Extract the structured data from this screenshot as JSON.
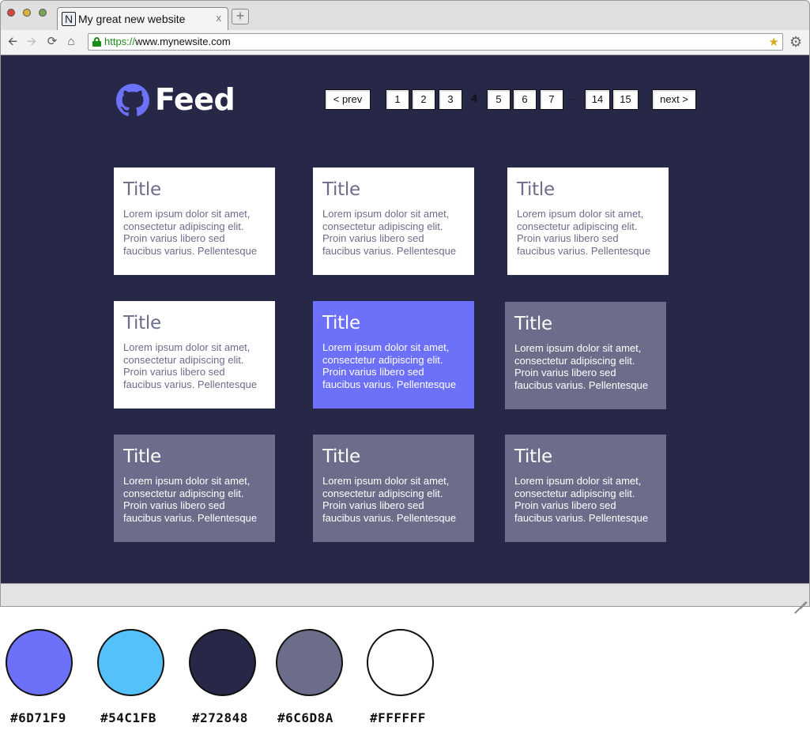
{
  "browser": {
    "tab_title": "My great new website",
    "tab_favicon": "N",
    "tab_close": "x",
    "new_tab": "+",
    "url_scheme": "https://",
    "url_rest": "www.mynewsite.com",
    "icons": [
      "back-arrow-icon",
      "forward-arrow-icon",
      "reload-icon",
      "home-icon",
      "lock-icon",
      "bookmark-star-icon",
      "settings-gear-icon",
      "resize-grip-icon"
    ]
  },
  "page": {
    "brand": "Feed",
    "logo": "github-octocat-icon",
    "background": "#272848"
  },
  "pagination": {
    "prev": "< prev",
    "next": "next >",
    "pages": [
      "1",
      "2",
      "3",
      "4",
      "5",
      "6",
      "7",
      "14",
      "15"
    ],
    "current": "4",
    "ellipsis": "..."
  },
  "cards": [
    {
      "title": "Title",
      "body": "Lorem ipsum dolor sit amet, consectetur adipiscing elit. Proin varius libero sed faucibus varius. Pellentesque",
      "style": "white"
    },
    {
      "title": "Title",
      "body": "Lorem ipsum dolor sit amet, consectetur adipiscing elit. Proin varius libero sed faucibus varius. Pellentesque",
      "style": "white"
    },
    {
      "title": "Title",
      "body": "Lorem ipsum dolor sit amet, consectetur adipiscing elit. Proin varius libero sed faucibus varius. Pellentesque",
      "style": "white"
    },
    {
      "title": "Title",
      "body": "Lorem ipsum dolor sit amet, consectetur adipiscing elit. Proin varius libero sed faucibus varius. Pellentesque",
      "style": "white"
    },
    {
      "title": "Title",
      "body": "Lorem ipsum dolor sit amet, consectetur adipiscing elit. Proin varius libero sed faucibus varius. Pellentesque",
      "style": "accent"
    },
    {
      "title": "Title",
      "body": "Lorem ipsum dolor sit amet, consectetur adipiscing elit. Proin varius libero sed faucibus varius. Pellentesque",
      "style": "muted"
    },
    {
      "title": "Title",
      "body": "Lorem ipsum dolor sit amet, consectetur adipiscing elit. Proin varius libero sed faucibus varius. Pellentesque",
      "style": "muted"
    },
    {
      "title": "Title",
      "body": "Lorem ipsum dolor sit amet, consectetur adipiscing elit. Proin varius libero sed faucibus varius. Pellentesque",
      "style": "muted"
    },
    {
      "title": "Title",
      "body": "Lorem ipsum dolor sit amet, consectetur adipiscing elit. Proin varius libero sed faucibus varius. Pellentesque",
      "style": "muted"
    }
  ],
  "palette": [
    {
      "hex": "#6D71F9",
      "label": "#6D71F9"
    },
    {
      "hex": "#54C1FB",
      "label": "#54C1FB"
    },
    {
      "hex": "#272848",
      "label": "#272848"
    },
    {
      "hex": "#6C6D8A",
      "label": "#6C6D8A"
    },
    {
      "hex": "#FFFFFF",
      "label": "#FFFFFF"
    }
  ]
}
